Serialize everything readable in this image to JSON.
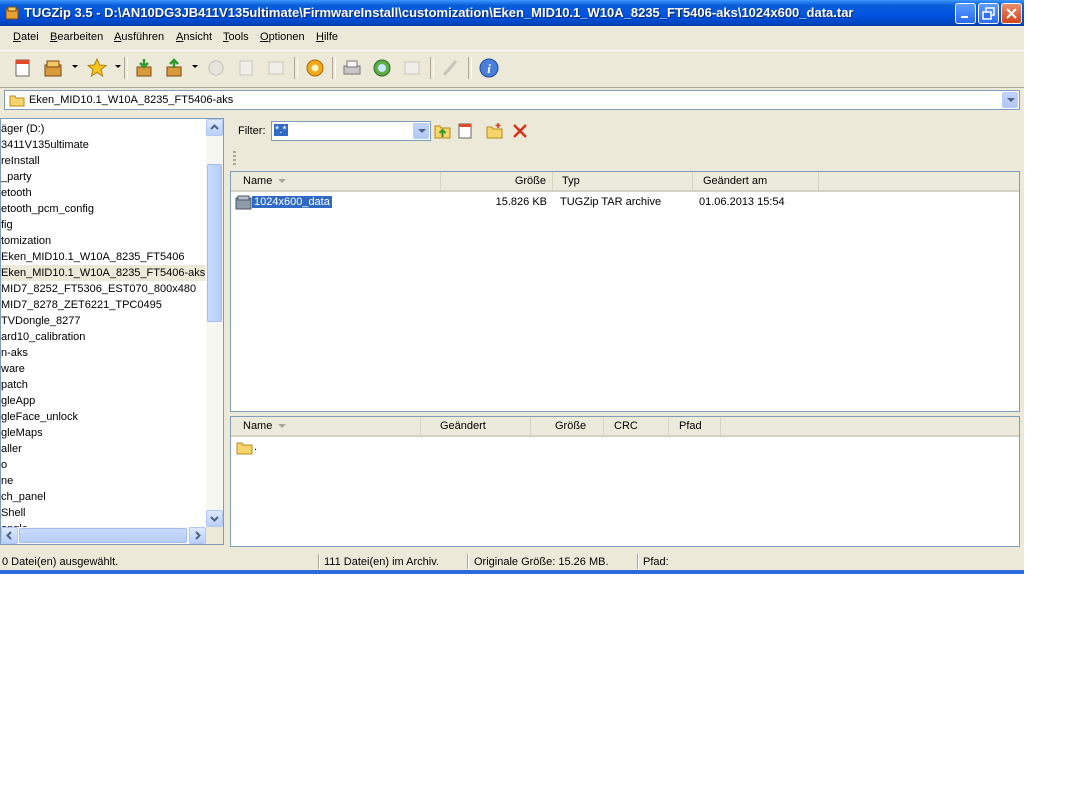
{
  "window": {
    "title": "TUGZip 3.5 - D:\\AN10DG3JB411V135ultimate\\FirmwareInstall\\customization\\Eken_MID10.1_W10A_8235_FT5406-aks\\1024x600_data.tar",
    "accent_color": "#0054e3"
  },
  "menu": [
    {
      "key": "D",
      "rest": "atei"
    },
    {
      "key": "B",
      "rest": "earbeiten"
    },
    {
      "key": "A",
      "rest": "usführen"
    },
    {
      "key": "A",
      "rest": "nsicht"
    },
    {
      "key": "T",
      "rest": "ools"
    },
    {
      "key": "O",
      "rest": "ptionen"
    },
    {
      "key": "H",
      "rest": "ilfe"
    }
  ],
  "toolbar_icons": [
    "new-archive-icon",
    "open-archive-icon",
    "favorites-icon",
    "extract-icon",
    "add-icon",
    "delete-icon",
    "view-icon",
    "test-icon",
    "repair-icon",
    "script-icon",
    "encrypt-icon",
    "convert-icon",
    "sfx-icon",
    "wizard-icon",
    "about-icon"
  ],
  "address": {
    "value": "Eken_MID10.1_W10A_8235_FT5406-aks"
  },
  "tree": {
    "items": [
      "äger (D:)",
      "3411V135ultimate",
      "reInstall",
      "_party",
      "etooth",
      "etooth_pcm_config",
      "fig",
      "tomization",
      "Eken_MID10.1_W10A_8235_FT5406",
      "Eken_MID10.1_W10A_8235_FT5406-aks",
      "MID7_8252_FT5306_EST070_800x480",
      "MID7_8278_ZET6221_TPC0495",
      "TVDongle_8277",
      "ard10_calibration",
      "n-aks",
      "ware",
      "patch",
      "gleApp",
      "gleFace_unlock",
      "gleMaps",
      "aller",
      "o",
      "ne",
      "ch_panel",
      "Shell",
      "ongle"
    ],
    "selected_index": 9
  },
  "filter": {
    "label": "Filter:",
    "value": "*.*"
  },
  "archive_list": {
    "columns": [
      "Name",
      "Größe",
      "Typ",
      "Geändert am"
    ],
    "rows": [
      {
        "name": "1024x600_data",
        "size": "15.826 KB",
        "type": "TUGZip TAR archive",
        "modified": "01.06.2013 15:54"
      }
    ]
  },
  "details_list": {
    "columns": [
      "Name",
      "Geändert",
      "Größe",
      "CRC",
      "Pfad"
    ],
    "rows": [
      {
        "name": "."
      }
    ]
  },
  "status": {
    "selected": "0 Datei(en) ausgewählt.",
    "count": "111 Datei(en) im Archiv.",
    "size": "Originale Größe: 15.26 MB.",
    "path": "Pfad:"
  }
}
